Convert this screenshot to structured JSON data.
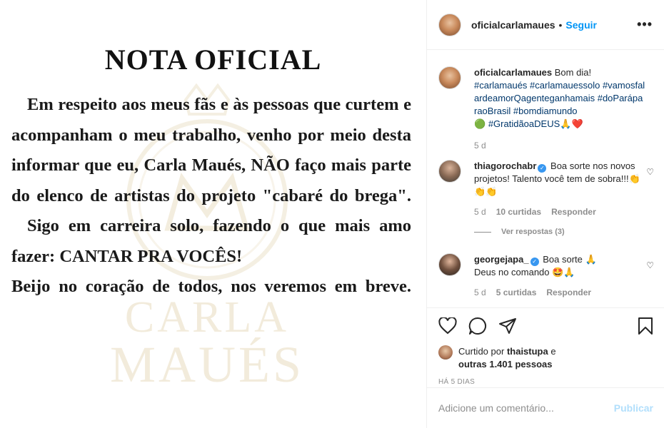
{
  "post_image": {
    "title": "NOTA OFICIAL",
    "paragraph1": "Em respeito aos meus fãs e às pessoas que curtem e acompanham o meu  trabalho, venho por meio desta informar que eu, Carla Maués, NÃO faço mais parte do elenco de artistas do projeto \"cabaré do brega\".",
    "paragraph2": "Sigo em carreira solo, fazendo o que mais amo  fazer: CANTAR PRA VOCÊS!",
    "paragraph3": "Beijo no coração de todos, nos veremos em breve.",
    "watermark_line1": "CARLA",
    "watermark_line2": "MAUÉS"
  },
  "header": {
    "username": "oficialcarlamaues",
    "separator": "•",
    "follow_label": "Seguir",
    "more_icon": "•••"
  },
  "caption": {
    "username": "oficialcarlamaues",
    "text": "Bom dia!",
    "hashtags_line1": "#carlamaués #carlamauessolo",
    "hashtags_line2": "#vamosfalardeamorQagenteganhamais #doParáparaoBrasil #bomdiamundo",
    "hashtag_last": "#GratidãoaDEUS",
    "leading_emoji": "🟢",
    "trailing_emojis": "🙏❤️",
    "time": "5 d"
  },
  "comments": [
    {
      "username": "thiagorochabr",
      "text": "Boa sorte nos novos projetos! Talento você tem de sobra!!!👏👏👏",
      "time": "5 d",
      "likes": "10 curtidas",
      "reply_label": "Responder",
      "view_replies": "Ver respostas (3)"
    },
    {
      "username": "georgejapa_",
      "text_line1": "Boa sorte 🙏",
      "text_line2": "Deus no comando 🤩🙏",
      "time": "5 d",
      "likes": "5 curtidas",
      "reply_label": "Responder"
    }
  ],
  "likes": {
    "prefix": "Curtido por",
    "user": "thaistupa",
    "conj": "e",
    "others": "outras 1.401 pessoas",
    "time_ago": "HÁ 5 DIAS"
  },
  "add_comment": {
    "placeholder": "Adicione um comentário...",
    "publish_label": "Publicar"
  },
  "colors": {
    "link_blue": "#0095f6",
    "hashtag": "#00376b",
    "muted": "#8e8e8e",
    "watermark_gold": "#c4a65c"
  }
}
